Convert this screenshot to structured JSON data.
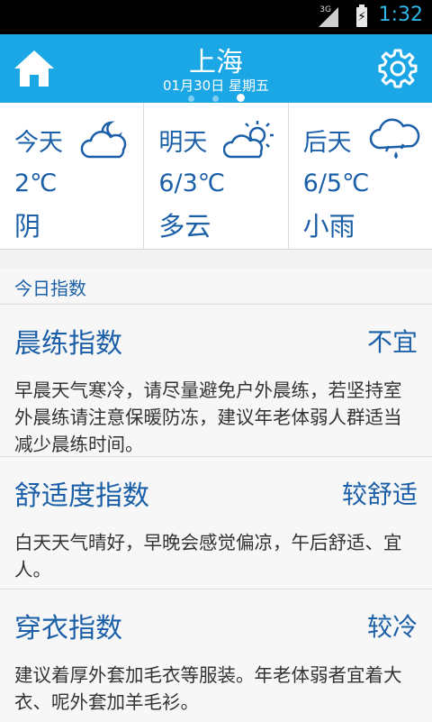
{
  "status_bar": {
    "network": "3G",
    "time": "1:32"
  },
  "header": {
    "city": "上海",
    "date": "01月30日 星期五",
    "page_indicator": {
      "count": 3,
      "active_index": 2
    },
    "home_icon": "home-icon",
    "settings_icon": "gear-icon"
  },
  "forecast": [
    {
      "day": "今天",
      "temp": "2℃",
      "condition": "阴",
      "icon": "cloudy-night-icon"
    },
    {
      "day": "明天",
      "temp": "6/3℃",
      "condition": "多云",
      "icon": "partly-cloudy-icon"
    },
    {
      "day": "后天",
      "temp": "6/5℃",
      "condition": "小雨",
      "icon": "rain-icon"
    }
  ],
  "indices": {
    "section_title": "今日指数",
    "items": [
      {
        "title": "晨练指数",
        "value": "不宜",
        "description": "早晨天气寒冷，请尽量避免户外晨练，若坚持室外晨练请注意保暖防冻，建议年老体弱人群适当减少晨练时间。"
      },
      {
        "title": "舒适度指数",
        "value": "较舒适",
        "description": "白天天气晴好，早晚会感觉偏凉，午后舒适、宜人。"
      },
      {
        "title": "穿衣指数",
        "value": "较冷",
        "description": "建议着厚外套加毛衣等服装。年老体弱者宜着大衣、呢外套加羊毛衫。"
      }
    ]
  },
  "colors": {
    "header_bg": "#1ba7e6",
    "text_blue": "#1a5fa8",
    "status_time": "#31b6e7"
  }
}
